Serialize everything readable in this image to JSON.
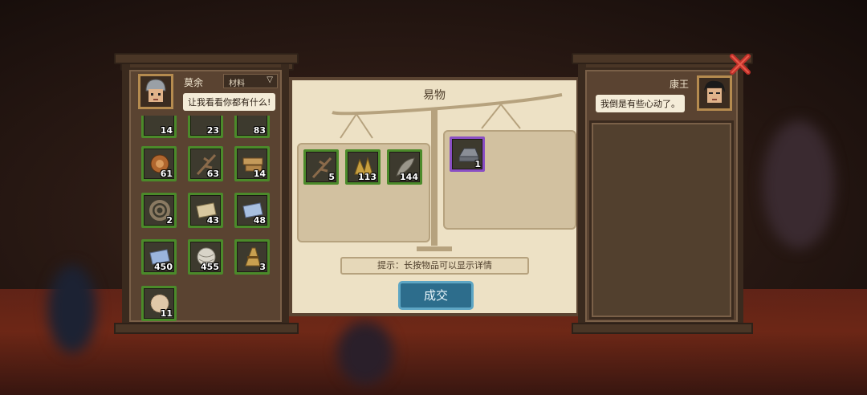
{
  "player": {
    "name": "莫余",
    "speech": "让我看看你都有什么!",
    "filter_label": "材料"
  },
  "merchant": {
    "name": "康王",
    "speech": "我倒是有些心动了。"
  },
  "trade": {
    "title": "易物",
    "hint": "提示：长按物品可以显示详情",
    "confirm_label": "成交"
  },
  "inventory": [
    {
      "icon": "item-icon",
      "count": "14"
    },
    {
      "icon": "item-icon",
      "count": "23"
    },
    {
      "icon": "item-icon",
      "count": "83"
    },
    {
      "icon": "wood-log-icon",
      "count": "61"
    },
    {
      "icon": "branch-icon",
      "count": "63"
    },
    {
      "icon": "timber-icon",
      "count": "14"
    },
    {
      "icon": "rope-coil-icon",
      "count": "2"
    },
    {
      "icon": "linen-cloth-icon",
      "count": "43"
    },
    {
      "icon": "blue-cloth-icon",
      "count": "48"
    },
    {
      "icon": "blue-cloth-icon",
      "count": "450"
    },
    {
      "icon": "yarn-ball-icon",
      "count": "455"
    },
    {
      "icon": "straw-bundle-icon",
      "count": "3"
    },
    {
      "icon": "fiber-icon",
      "count": "11"
    }
  ],
  "offer_left": [
    {
      "icon": "branch-icon",
      "count": "5"
    },
    {
      "icon": "hay-icon",
      "count": "113"
    },
    {
      "icon": "feather-icon",
      "count": "144"
    }
  ],
  "offer_right": [
    {
      "icon": "iron-ingot-icon",
      "count": "1"
    }
  ]
}
